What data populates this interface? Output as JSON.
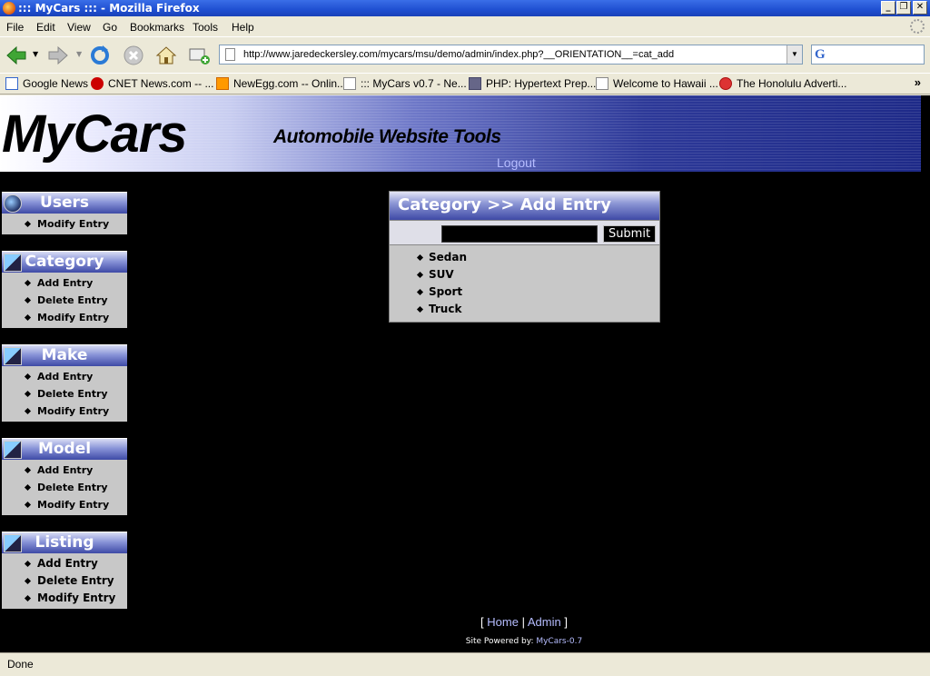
{
  "window": {
    "title": "::: MyCars ::: - Mozilla Firefox"
  },
  "menu": [
    "File",
    "Edit",
    "View",
    "Go",
    "Bookmarks",
    "Tools",
    "Help"
  ],
  "nav": {
    "url": "http://www.jaredeckersley.com/mycars/msu/demo/admin/index.php?__ORIENTATION__=cat_add",
    "search_engine_letter": "G"
  },
  "bookmarks": [
    {
      "label": "Google News",
      "icon": "google-icon"
    },
    {
      "label": "CNET News.com -- ...",
      "icon": "cnet-icon"
    },
    {
      "label": "NewEgg.com -- Onlin...",
      "icon": "newegg-icon"
    },
    {
      "label": "::: MyCars v0.7 - Ne...",
      "icon": "page-icon"
    },
    {
      "label": "PHP: Hypertext Prep...",
      "icon": "php-icon"
    },
    {
      "label": "Welcome to Hawaii ...",
      "icon": "page-icon"
    },
    {
      "label": "The Honolulu Adverti...",
      "icon": "flower-icon"
    }
  ],
  "site": {
    "logo": "MyCars",
    "tagline": "Automobile Website Tools",
    "logout": "Logout"
  },
  "sidebar": [
    {
      "title": "Users",
      "icon": "globe-icon",
      "items": [
        "Modify Entry"
      ]
    },
    {
      "title": "Category",
      "icon": "cube-icon",
      "items": [
        "Add Entry",
        "Delete Entry",
        "Modify Entry"
      ]
    },
    {
      "title": "Make",
      "icon": "cube-icon",
      "items": [
        "Add Entry",
        "Delete Entry",
        "Modify Entry"
      ]
    },
    {
      "title": "Model",
      "icon": "cube-icon",
      "items": [
        "Add Entry",
        "Delete Entry",
        "Modify Entry"
      ]
    },
    {
      "title": "Listing",
      "icon": "cube-icon",
      "items": [
        "Add Entry",
        "Delete Entry",
        "Modify Entry"
      ]
    }
  ],
  "panel": {
    "title": "Category >> Add Entry",
    "input_value": "",
    "submit": "Submit",
    "categories": [
      "Sedan",
      "SUV",
      "Sport",
      "Truck"
    ]
  },
  "footer": {
    "open": "[ ",
    "home": "Home",
    "sep": " | ",
    "admin": "Admin",
    "close": " ]",
    "powered_label": "Site Powered by: ",
    "powered_link": "MyCars-0.7"
  },
  "status": "Done",
  "colors": {
    "page_bg": "#000000",
    "link": "#b6bdff",
    "panel_bg": "#c8c8c8",
    "header_dark": "#3e4aa6"
  }
}
